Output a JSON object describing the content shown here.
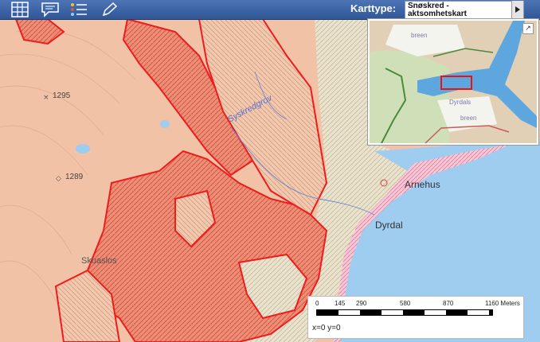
{
  "toolbar": {
    "karttype_label": "Karttype:",
    "selected_line1": "Snøskred -",
    "selected_line2": "aktsomhetskart",
    "icons": [
      "grid-icon",
      "comment-icon",
      "list-icon",
      "pencil-icon"
    ]
  },
  "map": {
    "labels": {
      "peak1": "1295",
      "peak2": "1289",
      "valley_stream": "Syskredgrov",
      "place1": "Arnehus",
      "place2": "Dyrdal",
      "place3": "Skuaslos"
    }
  },
  "overview": {
    "label_top": "breen",
    "label_place": "Dyrdals",
    "label_bottom": "breen"
  },
  "scale": {
    "ticks": [
      "0",
      "145",
      "290",
      "580",
      "870",
      "1160 Meters"
    ],
    "coords": "x=0 y=0"
  },
  "colors": {
    "toolbar": "#3a62a4",
    "hazard_red": "#ee1c1c",
    "fjord": "#9fcdf0"
  }
}
